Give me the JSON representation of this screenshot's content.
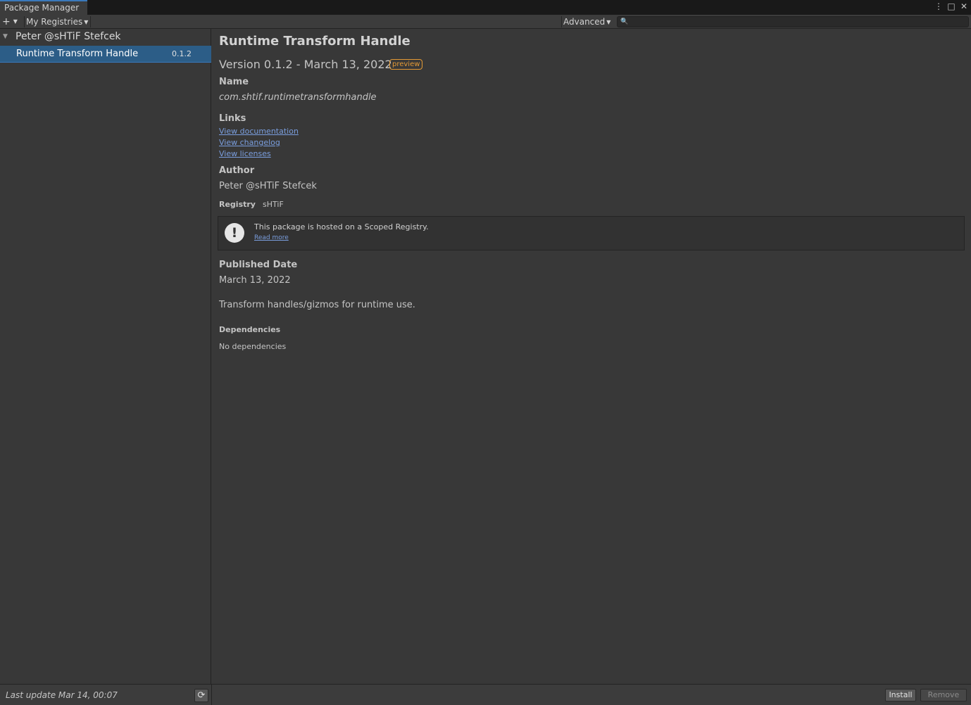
{
  "window": {
    "tab_title": "Package Manager",
    "icons": [
      "kebab-menu-icon",
      "maximize-icon",
      "close-icon"
    ]
  },
  "toolbar": {
    "add_label": "+",
    "registries_label": "My Registries",
    "advanced_label": "Advanced",
    "search_value": ""
  },
  "list": {
    "group": "Peter @sHTiF Stefcek",
    "packages": [
      {
        "name": "Runtime Transform Handle",
        "version": "0.1.2",
        "selected": true
      }
    ]
  },
  "footer": {
    "last_update": "Last update Mar 14, 00:07"
  },
  "details": {
    "title": "Runtime Transform Handle",
    "version_line": "Version 0.1.2 - March 13, 2022",
    "badge": "preview",
    "name_label": "Name",
    "name_value": "com.shtif.runtimetransformhandle",
    "links_label": "Links",
    "links": [
      "View documentation",
      "View changelog",
      "View licenses"
    ],
    "author_label": "Author",
    "author_value": "Peter @sHTiF Stefcek",
    "registry_label": "Registry",
    "registry_value": "sHTiF",
    "info_message": "This package is hosted on a Scoped Registry.",
    "info_link": "Read more",
    "published_label": "Published Date",
    "published_value": "March 13,  2022",
    "description": "Transform handles/gizmos for runtime use.",
    "dependencies_label": "Dependencies",
    "dependencies_value": "No dependencies"
  },
  "actions": {
    "install": "Install",
    "remove": "Remove"
  },
  "colors": {
    "accent": "#3a79bb",
    "selection": "#2c5d87",
    "badge": "#e49a35",
    "link": "#7a9ede"
  }
}
